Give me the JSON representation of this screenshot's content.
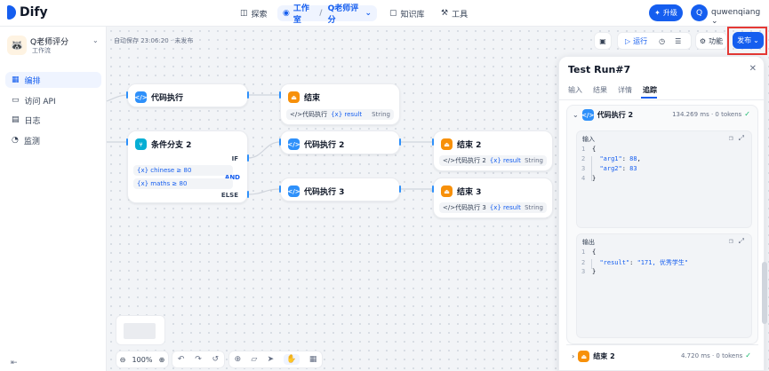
{
  "topbar": {
    "logo": "Dify",
    "nav": [
      {
        "label": "探索",
        "icon": "compass-icon"
      },
      {
        "label": "工作室",
        "icon": "studio-icon"
      },
      {
        "label": "Q老师评分",
        "icon": "app-icon"
      },
      {
        "label": "知识库",
        "icon": "book-icon"
      },
      {
        "label": "工具",
        "icon": "tool-icon"
      }
    ],
    "upgrade_label": "升级",
    "avatar_initial": "Q",
    "username": "quwenqiang"
  },
  "sidebar": {
    "app_name": "Q老师评分",
    "app_type": "工作流",
    "items": [
      {
        "label": "编排",
        "icon": "grid-icon"
      },
      {
        "label": "访问 API",
        "icon": "api-icon"
      },
      {
        "label": "日志",
        "icon": "log-icon"
      },
      {
        "label": "监测",
        "icon": "monitor-icon"
      }
    ]
  },
  "canvas": {
    "autosave": "自动保存 23:06:20 · 未发布",
    "toolbar": {
      "run_label": "运行",
      "feature_label": "功能",
      "publish_label": "发布"
    },
    "nodes": {
      "code1": {
        "title": "代码执行"
      },
      "end1": {
        "title": "结束",
        "var_source": "代码执行",
        "var_name": "{x} result",
        "var_type": "String"
      },
      "ifelse": {
        "title": "条件分支 2",
        "if_label": "IF",
        "cond1": "{x} chinese ≥ 80",
        "and_label": "AND",
        "cond2": "{x} maths ≥ 80",
        "else_label": "ELSE"
      },
      "code2": {
        "title": "代码执行 2"
      },
      "code3": {
        "title": "代码执行 3"
      },
      "end2": {
        "title": "结束 2",
        "var_source": "代码执行 2",
        "var_name": "{x} result",
        "var_type": "String"
      },
      "end3": {
        "title": "结束 3",
        "var_source": "代码执行 3",
        "var_name": "{x} result",
        "var_type": "String"
      }
    },
    "zoom": "100%"
  },
  "panel": {
    "title": "Test Run#7",
    "tabs": [
      "输入",
      "结果",
      "详情",
      "追踪"
    ],
    "trace": {
      "node_title": "代码执行 2",
      "meta": "134.269 ms · 0 tokens",
      "input_title": "输入",
      "output_title": "输出",
      "next_node_title": "结束 2",
      "next_meta": "4.720 ms · 0 tokens"
    }
  }
}
